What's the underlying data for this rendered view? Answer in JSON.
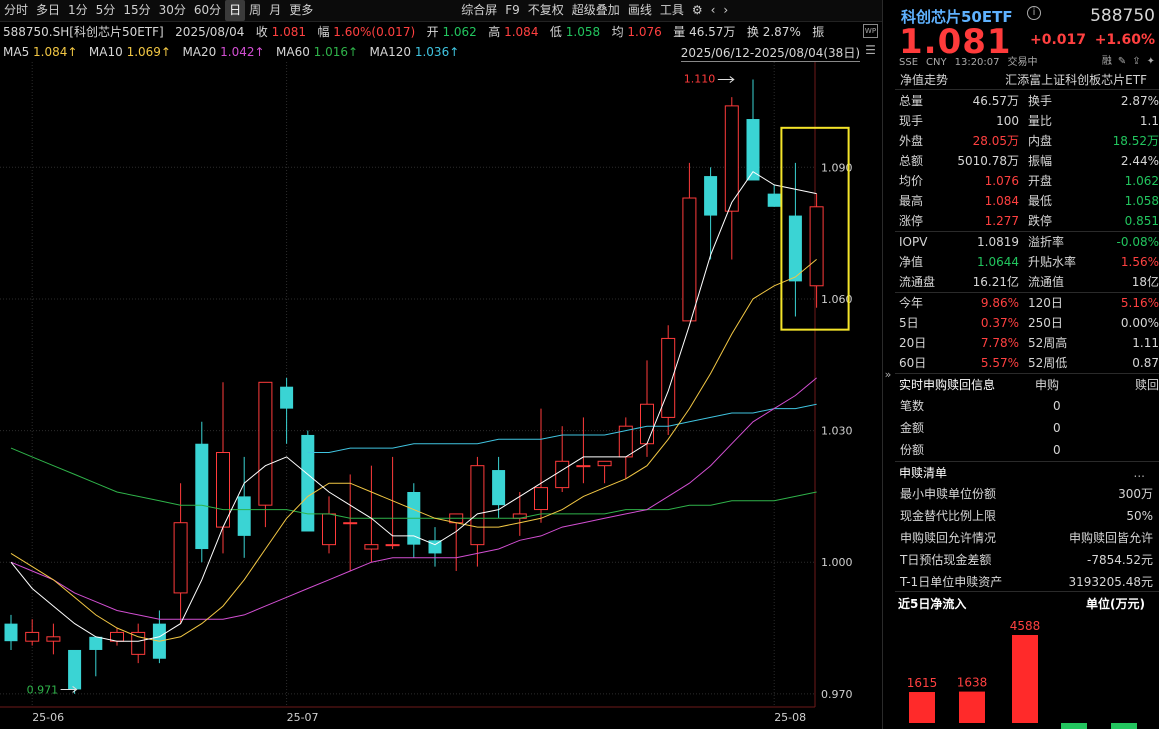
{
  "toolbar": {
    "periods": [
      "分时",
      "多日",
      "1分",
      "5分",
      "15分",
      "30分",
      "60分",
      "日",
      "周",
      "月",
      "更多"
    ],
    "active": "日",
    "tools": [
      "综合屏",
      "F9",
      "不复权",
      "超级叠加",
      "画线",
      "工具"
    ]
  },
  "info": {
    "symbol": "588750.SH[科创芯片50ETF]",
    "date": "2025/08/04",
    "close_label": "收",
    "close": "1.081",
    "chg_label": "幅",
    "chg": "1.60%(0.017)",
    "open_label": "开",
    "open": "1.062",
    "high_label": "高",
    "high": "1.084",
    "low_label": "低",
    "low": "1.058",
    "avg_label": "均",
    "avg": "1.076",
    "vol_label": "量",
    "vol": "46.57万",
    "turn_label": "换",
    "turn": "2.87%",
    "amp_label": "振"
  },
  "ma": {
    "ma5_label": "MA5",
    "ma5": "1.084↑",
    "ma10_label": "MA10",
    "ma10": "1.069↑",
    "ma20_label": "MA20",
    "ma20": "1.042↑",
    "ma60_label": "MA60",
    "ma60": "1.016↑",
    "ma120_label": "MA120",
    "ma120": "1.036↑",
    "range": "2025/06/12-2025/08/04(38日)"
  },
  "colors": {
    "up": "#ff3b3b",
    "down": "#3ad4d4",
    "ma5": "#ffffff",
    "ma10": "#f2c744",
    "ma20": "#d24fd2",
    "ma60": "#2fb34a",
    "ma120": "#40c4e0",
    "highlight": "#f5e52a"
  },
  "chart_data": {
    "type": "candlestick",
    "ylim": [
      0.967,
      1.114
    ],
    "y_ticks": [
      0.97,
      1.0,
      1.03,
      1.06,
      1.09
    ],
    "y_tick_labels": [
      "0.970",
      "1.000",
      "1.030",
      "1.060",
      "1.090"
    ],
    "x_labels": [
      {
        "i": 1,
        "text": "25-06"
      },
      {
        "i": 13,
        "text": "25-07"
      },
      {
        "i": 36,
        "text": "25-08"
      }
    ],
    "annotations": {
      "high_text": "1.110",
      "high_index": 34,
      "high_value": 1.11,
      "low_text": "0.971",
      "low_index": 3,
      "low_value": 0.971
    },
    "candles": [
      [
        0.986,
        0.982,
        0.988,
        0.98
      ],
      [
        0.982,
        0.984,
        0.987,
        0.981
      ],
      [
        0.982,
        0.983,
        0.986,
        0.979
      ],
      [
        0.98,
        0.971,
        0.979,
        0.97
      ],
      [
        0.983,
        0.98,
        0.983,
        0.974
      ],
      [
        0.982,
        0.984,
        0.985,
        0.981
      ],
      [
        0.979,
        0.984,
        0.986,
        0.977
      ],
      [
        0.986,
        0.978,
        0.989,
        0.977
      ],
      [
        0.993,
        1.009,
        1.018,
        0.986
      ],
      [
        1.027,
        1.003,
        1.032,
        1.0
      ],
      [
        1.008,
        1.025,
        1.041,
        1.002
      ],
      [
        1.015,
        1.006,
        1.024,
        1.001
      ],
      [
        1.013,
        1.041,
        1.041,
        1.008
      ],
      [
        1.04,
        1.035,
        1.042,
        1.027
      ],
      [
        1.029,
        1.007,
        1.03,
        1.009
      ],
      [
        1.004,
        1.011,
        1.015,
        1.002
      ],
      [
        1.009,
        1.009,
        1.02,
        0.998
      ],
      [
        1.003,
        1.004,
        1.022,
        1.0
      ],
      [
        1.004,
        1.004,
        1.024,
        1.003
      ],
      [
        1.016,
        1.004,
        1.018,
        1.001
      ],
      [
        1.005,
        1.002,
        1.008,
        0.999
      ],
      [
        1.009,
        1.011,
        1.011,
        0.998
      ],
      [
        1.004,
        1.022,
        1.024,
        0.999
      ],
      [
        1.021,
        1.013,
        1.024,
        1.01
      ],
      [
        1.01,
        1.011,
        1.016,
        1.006
      ],
      [
        1.012,
        1.017,
        1.035,
        1.009
      ],
      [
        1.017,
        1.023,
        1.031,
        1.016
      ],
      [
        1.022,
        1.022,
        1.033,
        1.018
      ],
      [
        1.022,
        1.023,
        1.023,
        1.018
      ],
      [
        1.024,
        1.031,
        1.033,
        1.019
      ],
      [
        1.027,
        1.036,
        1.046,
        1.024
      ],
      [
        1.033,
        1.051,
        1.054,
        1.029
      ],
      [
        1.055,
        1.083,
        1.091,
        1.061
      ],
      [
        1.088,
        1.079,
        1.09,
        1.069
      ],
      [
        1.08,
        1.104,
        1.106,
        1.069
      ],
      [
        1.101,
        1.087,
        1.11,
        1.091
      ],
      [
        1.084,
        1.081,
        1.086,
        1.081
      ],
      [
        1.079,
        1.064,
        1.091,
        1.056
      ],
      [
        1.063,
        1.081,
        1.084,
        1.058
      ]
    ],
    "ma5": [
      1.0,
      0.994,
      0.99,
      0.986,
      0.983,
      0.982,
      0.982,
      0.983,
      0.986,
      0.996,
      1.008,
      1.018,
      1.022,
      1.024,
      1.02,
      1.016,
      1.013,
      1.01,
      1.006,
      1.006,
      1.004,
      1.007,
      1.011,
      1.012,
      1.015,
      1.018,
      1.021,
      1.024,
      1.024,
      1.024,
      1.027,
      1.039,
      1.054,
      1.07,
      1.082,
      1.089,
      1.086,
      1.085,
      1.084
    ],
    "ma10": [
      1.002,
      0.999,
      0.996,
      0.992,
      0.988,
      0.985,
      0.983,
      0.982,
      0.983,
      0.986,
      0.99,
      0.996,
      1.003,
      1.01,
      1.015,
      1.018,
      1.018,
      1.016,
      1.014,
      1.012,
      1.01,
      1.009,
      1.008,
      1.008,
      1.009,
      1.01,
      1.012,
      1.015,
      1.017,
      1.019,
      1.022,
      1.028,
      1.035,
      1.043,
      1.052,
      1.06,
      1.063,
      1.065,
      1.069
    ],
    "ma20": [
      1.0,
      0.998,
      0.996,
      0.993,
      0.991,
      0.989,
      0.988,
      0.987,
      0.987,
      0.987,
      0.987,
      0.988,
      0.99,
      0.992,
      0.994,
      0.996,
      0.998,
      1.0,
      1.001,
      1.001,
      1.001,
      1.001,
      1.002,
      1.003,
      1.005,
      1.006,
      1.008,
      1.009,
      1.01,
      1.011,
      1.012,
      1.015,
      1.018,
      1.022,
      1.027,
      1.032,
      1.035,
      1.038,
      1.042
    ],
    "ma60": [
      1.026,
      1.024,
      1.022,
      1.02,
      1.018,
      1.016,
      1.015,
      1.014,
      1.013,
      1.013,
      1.012,
      1.012,
      1.012,
      1.012,
      1.011,
      1.011,
      1.01,
      1.01,
      1.01,
      1.01,
      1.01,
      1.01,
      1.01,
      1.01,
      1.01,
      1.011,
      1.011,
      1.011,
      1.011,
      1.012,
      1.012,
      1.012,
      1.013,
      1.013,
      1.014,
      1.014,
      1.014,
      1.015,
      1.016
    ],
    "ma120": [
      null,
      null,
      null,
      null,
      null,
      null,
      null,
      null,
      null,
      null,
      null,
      null,
      null,
      null,
      1.025,
      1.025,
      1.026,
      1.026,
      1.026,
      1.027,
      1.027,
      1.027,
      1.027,
      1.028,
      1.028,
      1.028,
      1.029,
      1.029,
      1.029,
      1.03,
      1.031,
      1.031,
      1.032,
      1.033,
      1.034,
      1.034,
      1.035,
      1.035,
      1.036
    ]
  },
  "header": {
    "name": "科创芯片50ETF",
    "code": "588750",
    "price": "1.081",
    "change": "+0.017",
    "pct": "+1.60%",
    "market": "SSE",
    "currency": "CNY",
    "time": "13:20:07",
    "status": "交易中",
    "icon_label": "融"
  },
  "nav": {
    "left": "净值走势",
    "right": "汇添富上证科创板芯片ETF"
  },
  "stats": [
    {
      "l1": "总量",
      "v1": "46.57万",
      "c1": "w",
      "l2": "换手",
      "v2": "2.87%",
      "c2": "w"
    },
    {
      "l1": "现手",
      "v1": "100",
      "c1": "w",
      "l2": "量比",
      "v2": "1.1",
      "c2": "w"
    },
    {
      "l1": "外盘",
      "v1": "28.05万",
      "c1": "r",
      "l2": "内盘",
      "v2": "18.52万",
      "c2": "g"
    },
    {
      "l1": "总额",
      "v1": "5010.78万",
      "c1": "w",
      "l2": "振幅",
      "v2": "2.44%",
      "c2": "w"
    },
    {
      "l1": "均价",
      "v1": "1.076",
      "c1": "r",
      "l2": "开盘",
      "v2": "1.062",
      "c2": "g"
    },
    {
      "l1": "最高",
      "v1": "1.084",
      "c1": "r",
      "l2": "最低",
      "v2": "1.058",
      "c2": "g"
    },
    {
      "l1": "涨停",
      "v1": "1.277",
      "c1": "r",
      "l2": "跌停",
      "v2": "0.851",
      "c2": "g"
    }
  ],
  "stats2": [
    {
      "l1": "IOPV",
      "v1": "1.0819",
      "c1": "w",
      "l2": "溢折率",
      "v2": "-0.08%",
      "c2": "g"
    },
    {
      "l1": "净值",
      "v1": "1.0644",
      "c1": "g",
      "l2": "升贴水率",
      "v2": "1.56%",
      "c2": "r"
    },
    {
      "l1": "流通盘",
      "v1": "16.21亿",
      "c1": "w",
      "l2": "流通值",
      "v2": "18亿",
      "c2": "w"
    }
  ],
  "stats3": [
    {
      "l1": "今年",
      "v1": "9.86%",
      "c1": "r",
      "l2": "120日",
      "v2": "5.16%",
      "c2": "r"
    },
    {
      "l1": "5日",
      "v1": "0.37%",
      "c1": "r",
      "l2": "250日",
      "v2": "0.00%",
      "c2": "w"
    },
    {
      "l1": "20日",
      "v1": "7.78%",
      "c1": "r",
      "l2": "52周高",
      "v2": "1.11",
      "c2": "w"
    },
    {
      "l1": "60日",
      "v1": "5.57%",
      "c1": "r",
      "l2": "52周低",
      "v2": "0.87",
      "c2": "w"
    }
  ],
  "subscribe": {
    "title": "实时申购赎回信息",
    "col1": "申购",
    "col2": "赎回",
    "rows": [
      {
        "l": "笔数",
        "v": "0"
      },
      {
        "l": "金额",
        "v": "0"
      },
      {
        "l": "份额",
        "v": "0"
      }
    ]
  },
  "list": {
    "title": "申赎清单",
    "dots": "...",
    "rows": [
      {
        "l": "最小申赎单位份额",
        "v": "300万"
      },
      {
        "l": "现金替代比例上限",
        "v": "50%"
      },
      {
        "l": "申购赎回允许情况",
        "v": "申购赎回皆允许"
      },
      {
        "l": "T日预估现金差额",
        "v": "-7854.52元"
      },
      {
        "l": "T-1日单位申赎资产",
        "v": "3193205.48元"
      }
    ]
  },
  "flow": {
    "title": "近5日净流入",
    "unit": "单位(万元)",
    "values": [
      1615,
      1638,
      4588,
      -300,
      -300
    ],
    "labels": [
      "1615",
      "1638",
      "4588",
      "",
      ""
    ]
  }
}
